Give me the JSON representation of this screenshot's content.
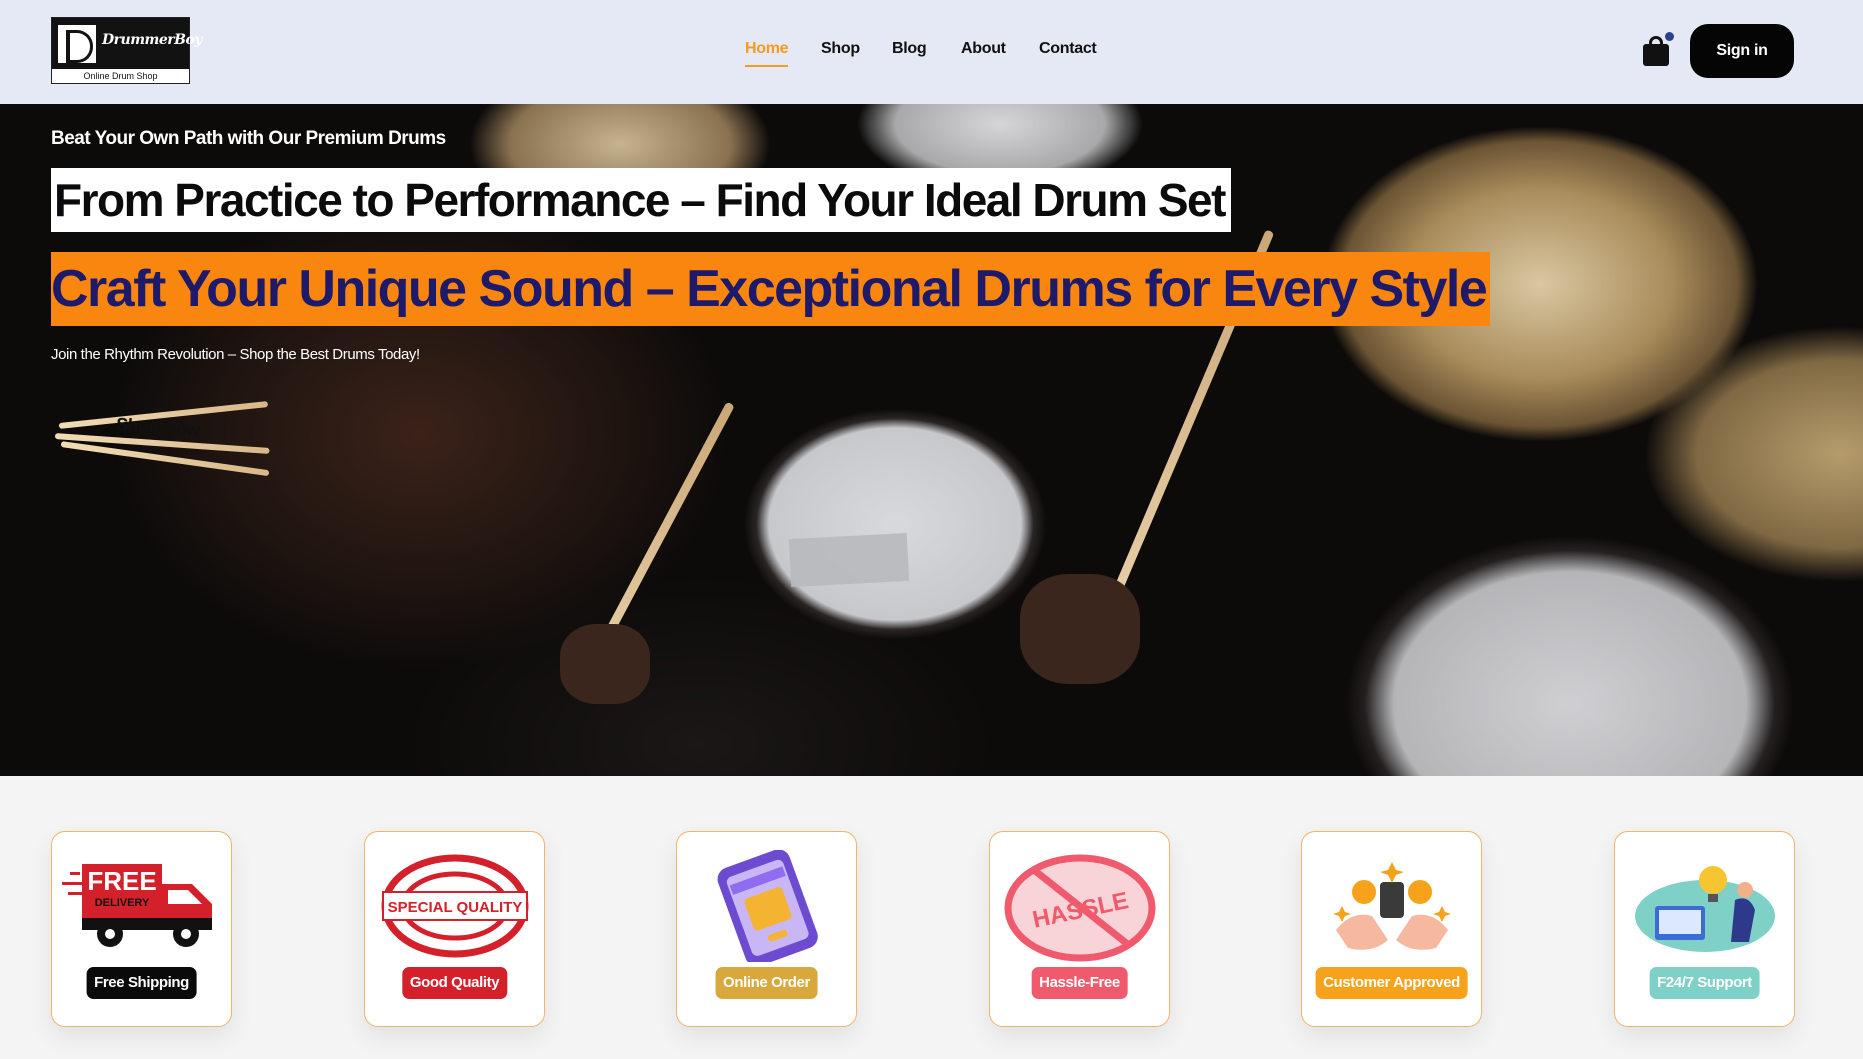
{
  "brand": {
    "name": "DrummerBoy",
    "tagline": "Online Drum Shop"
  },
  "nav": {
    "items": [
      {
        "label": "Home",
        "active": true
      },
      {
        "label": "Shop",
        "active": false
      },
      {
        "label": "Blog",
        "active": false
      },
      {
        "label": "About",
        "active": false
      },
      {
        "label": "Contact",
        "active": false
      }
    ],
    "accent_color": "#f59a23"
  },
  "header": {
    "cart_icon": "shopping-bag-icon",
    "signin_label": "Sign in"
  },
  "hero": {
    "tagline": "Beat Your Own Path with Our Premium Drums",
    "heading_1": "From Practice to Performance – Find Your Ideal Drum Set",
    "heading_2": "Craft Your Unique Sound – Exceptional Drums for Every Style",
    "subtext": "Join the Rhythm Revolution – Shop the Best Drums Today!",
    "cta_label": "Shop Now",
    "highlight_color": "#f9860f",
    "heading_2_color": "#1d1a6b"
  },
  "features": [
    {
      "label": "Free Shipping",
      "icon": "delivery-truck-icon",
      "badge_color": "#0a0a0a"
    },
    {
      "label": "Good Quality",
      "icon": "special-quality-stamp-icon",
      "badge_color": "#d3202a"
    },
    {
      "label": "Online Order",
      "icon": "shopping-phone-icon",
      "badge_color": "#d8a83c"
    },
    {
      "label": "Hassle-Free",
      "icon": "no-hassle-icon",
      "badge_color": "#ef5b6c"
    },
    {
      "label": "Customer Approved",
      "icon": "approval-hands-icon",
      "badge_color": "#f7a21b"
    },
    {
      "label": "F24/7 Support",
      "icon": "support-lightbulb-icon",
      "badge_color": "#7fd1c7"
    }
  ],
  "feature_art_text": {
    "free": "FREE",
    "delivery": "DELIVERY",
    "special_quality": "SPECIAL QUALITY",
    "hassle": "HASSLE"
  }
}
